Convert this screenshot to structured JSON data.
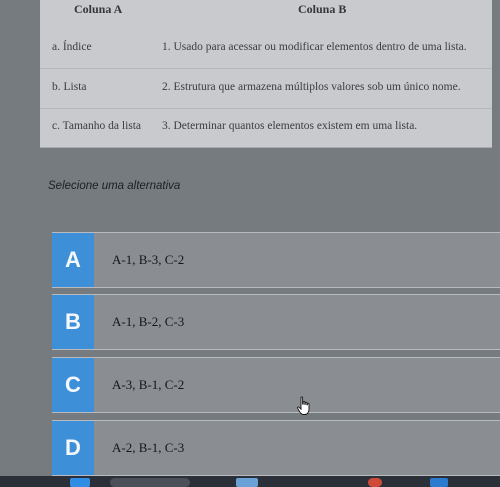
{
  "table": {
    "header": {
      "col_a": "Coluna A",
      "col_b": "Coluna B"
    },
    "rows": [
      {
        "a": "a. Índice",
        "b": "1. Usado para acessar ou modificar elementos dentro de uma lista."
      },
      {
        "a": "b. Lista",
        "b": "2. Estrutura que armazena múltiplos valores sob um único nome."
      },
      {
        "a": "c. Tamanho da lista",
        "b": "3. Determinar quantos elementos existem em uma lista."
      }
    ]
  },
  "prompt": "Selecione uma alternativa",
  "options": [
    {
      "letter": "A",
      "text": "A-1, B-3, C-2"
    },
    {
      "letter": "B",
      "text": "A-1, B-2, C-3"
    },
    {
      "letter": "C",
      "text": "A-3, B-1, C-2"
    },
    {
      "letter": "D",
      "text": "A-2, B-1, C-3"
    }
  ],
  "colors": {
    "badge": "#3d8fd8",
    "option_bg": "#8a8e93",
    "table_bg": "#c8cacd",
    "taskbar": "#2b3038"
  },
  "icons": {
    "cursor": "hand-pointer-icon",
    "taskbar": [
      "windows-start-icon",
      "search-icon",
      "app-icon",
      "browser-icon",
      "file-explorer-icon"
    ]
  }
}
